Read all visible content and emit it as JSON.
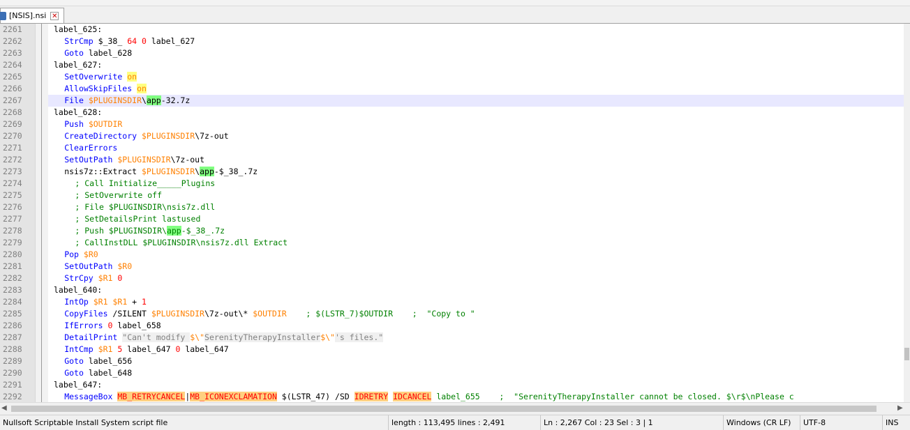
{
  "tab": {
    "label": "[NSIS].nsi",
    "close_icon": "close-icon",
    "file_icon": "save-disk-icon"
  },
  "colors": {
    "keyword": "#0000ff",
    "variable": "#ff8000",
    "number": "#ff0000",
    "comment": "#008000",
    "string": "#808080",
    "current_line": "#e8e8ff"
  },
  "editor": {
    "current_line": 2267,
    "lines": [
      {
        "num": "2261",
        "tokens": [
          {
            "t": "label_625:",
            "c": "default"
          }
        ],
        "indent": 0
      },
      {
        "num": "2262",
        "tokens": [
          {
            "t": "StrCmp",
            "c": "keyword"
          },
          {
            "t": " $_38_ ",
            "c": "default"
          },
          {
            "t": "64",
            "c": "number"
          },
          {
            "t": " ",
            "c": "default"
          },
          {
            "t": "0",
            "c": "number"
          },
          {
            "t": " label_627",
            "c": "default"
          }
        ],
        "indent": 2
      },
      {
        "num": "2263",
        "tokens": [
          {
            "t": "Goto",
            "c": "keyword"
          },
          {
            "t": " label_628",
            "c": "default"
          }
        ],
        "indent": 2
      },
      {
        "num": "2264",
        "tokens": [
          {
            "t": "label_627:",
            "c": "default"
          }
        ],
        "indent": 0
      },
      {
        "num": "2265",
        "tokens": [
          {
            "t": "SetOverwrite",
            "c": "keyword"
          },
          {
            "t": " ",
            "c": "default"
          },
          {
            "t": "on",
            "c": "variable",
            "hl": "yellow"
          }
        ],
        "indent": 2
      },
      {
        "num": "2266",
        "tokens": [
          {
            "t": "AllowSkipFiles",
            "c": "keyword"
          },
          {
            "t": " ",
            "c": "default"
          },
          {
            "t": "on",
            "c": "variable",
            "hl": "yellow"
          }
        ],
        "indent": 2
      },
      {
        "num": "2267",
        "tokens": [
          {
            "t": "File",
            "c": "keyword"
          },
          {
            "t": " ",
            "c": "default"
          },
          {
            "t": "$PLUGINSDIR",
            "c": "variable"
          },
          {
            "t": "\\",
            "c": "default"
          },
          {
            "t": "app",
            "c": "default",
            "hl": "green"
          },
          {
            "t": "-32.7z",
            "c": "default"
          }
        ],
        "indent": 2
      },
      {
        "num": "2268",
        "tokens": [
          {
            "t": "label_628:",
            "c": "default"
          }
        ],
        "indent": 0
      },
      {
        "num": "2269",
        "tokens": [
          {
            "t": "Push",
            "c": "keyword"
          },
          {
            "t": " ",
            "c": "default"
          },
          {
            "t": "$OUTDIR",
            "c": "variable"
          }
        ],
        "indent": 2
      },
      {
        "num": "2270",
        "tokens": [
          {
            "t": "CreateDirectory",
            "c": "keyword"
          },
          {
            "t": " ",
            "c": "default"
          },
          {
            "t": "$PLUGINSDIR",
            "c": "variable"
          },
          {
            "t": "\\7z-out",
            "c": "default"
          }
        ],
        "indent": 2
      },
      {
        "num": "2271",
        "tokens": [
          {
            "t": "ClearErrors",
            "c": "keyword"
          }
        ],
        "indent": 2
      },
      {
        "num": "2272",
        "tokens": [
          {
            "t": "SetOutPath",
            "c": "keyword"
          },
          {
            "t": " ",
            "c": "default"
          },
          {
            "t": "$PLUGINSDIR",
            "c": "variable"
          },
          {
            "t": "\\7z-out",
            "c": "default"
          }
        ],
        "indent": 2
      },
      {
        "num": "2273",
        "tokens": [
          {
            "t": "nsis7z::Extract",
            "c": "default"
          },
          {
            "t": " ",
            "c": "default"
          },
          {
            "t": "$PLUGINSDIR",
            "c": "variable"
          },
          {
            "t": "\\",
            "c": "default"
          },
          {
            "t": "app",
            "c": "default",
            "hl": "green"
          },
          {
            "t": "-$_38_.7z",
            "c": "default"
          }
        ],
        "indent": 2
      },
      {
        "num": "2274",
        "tokens": [
          {
            "t": "; Call Initialize_____Plugins",
            "c": "comment"
          }
        ],
        "indent": 4
      },
      {
        "num": "2275",
        "tokens": [
          {
            "t": "; SetOverwrite off",
            "c": "comment"
          }
        ],
        "indent": 4
      },
      {
        "num": "2276",
        "tokens": [
          {
            "t": "; File $PLUGINSDIR\\nsis7z.dll",
            "c": "comment"
          }
        ],
        "indent": 4
      },
      {
        "num": "2277",
        "tokens": [
          {
            "t": "; SetDetailsPrint lastused",
            "c": "comment"
          }
        ],
        "indent": 4
      },
      {
        "num": "2278",
        "tokens": [
          {
            "t": "; Push $PLUGINSDIR\\",
            "c": "comment"
          },
          {
            "t": "app",
            "c": "comment",
            "hl": "green"
          },
          {
            "t": "-$_38_.7z",
            "c": "comment"
          }
        ],
        "indent": 4
      },
      {
        "num": "2279",
        "tokens": [
          {
            "t": "; CallInstDLL $PLUGINSDIR\\nsis7z.dll Extract",
            "c": "comment"
          }
        ],
        "indent": 4
      },
      {
        "num": "2280",
        "tokens": [
          {
            "t": "Pop",
            "c": "keyword"
          },
          {
            "t": " ",
            "c": "default"
          },
          {
            "t": "$R0",
            "c": "variable"
          }
        ],
        "indent": 2
      },
      {
        "num": "2281",
        "tokens": [
          {
            "t": "SetOutPath",
            "c": "keyword"
          },
          {
            "t": " ",
            "c": "default"
          },
          {
            "t": "$R0",
            "c": "variable"
          }
        ],
        "indent": 2
      },
      {
        "num": "2282",
        "tokens": [
          {
            "t": "StrCpy",
            "c": "keyword"
          },
          {
            "t": " ",
            "c": "default"
          },
          {
            "t": "$R1",
            "c": "variable"
          },
          {
            "t": " ",
            "c": "default"
          },
          {
            "t": "0",
            "c": "number"
          }
        ],
        "indent": 2
      },
      {
        "num": "2283",
        "tokens": [
          {
            "t": "label_640:",
            "c": "default"
          }
        ],
        "indent": 0
      },
      {
        "num": "2284",
        "tokens": [
          {
            "t": "IntOp",
            "c": "keyword"
          },
          {
            "t": " ",
            "c": "default"
          },
          {
            "t": "$R1",
            "c": "variable"
          },
          {
            "t": " ",
            "c": "default"
          },
          {
            "t": "$R1",
            "c": "variable"
          },
          {
            "t": " + ",
            "c": "default"
          },
          {
            "t": "1",
            "c": "number"
          }
        ],
        "indent": 2
      },
      {
        "num": "2285",
        "tokens": [
          {
            "t": "CopyFiles",
            "c": "keyword"
          },
          {
            "t": " /SILENT ",
            "c": "default"
          },
          {
            "t": "$PLUGINSDIR",
            "c": "variable"
          },
          {
            "t": "\\7z-out\\* ",
            "c": "default"
          },
          {
            "t": "$OUTDIR",
            "c": "variable"
          },
          {
            "t": "    ; $(LSTR_7)$OUTDIR    ;  \"Copy to \"",
            "c": "comment"
          }
        ],
        "indent": 2
      },
      {
        "num": "2286",
        "tokens": [
          {
            "t": "IfErrors",
            "c": "keyword"
          },
          {
            "t": " ",
            "c": "default"
          },
          {
            "t": "0",
            "c": "number"
          },
          {
            "t": " label_658",
            "c": "default"
          }
        ],
        "indent": 2
      },
      {
        "num": "2287",
        "tokens": [
          {
            "t": "DetailPrint",
            "c": "keyword"
          },
          {
            "t": " ",
            "c": "default"
          },
          {
            "t": "\"Can't modify ",
            "c": "string"
          },
          {
            "t": "$\\\"",
            "c": "variable"
          },
          {
            "t": "SerenityTherapyInstaller",
            "c": "string"
          },
          {
            "t": "$\\\"",
            "c": "variable"
          },
          {
            "t": "'s files.\"",
            "c": "string"
          }
        ],
        "indent": 2
      },
      {
        "num": "2288",
        "tokens": [
          {
            "t": "IntCmp",
            "c": "keyword"
          },
          {
            "t": " ",
            "c": "default"
          },
          {
            "t": "$R1",
            "c": "variable"
          },
          {
            "t": " ",
            "c": "default"
          },
          {
            "t": "5",
            "c": "number"
          },
          {
            "t": " label_647 ",
            "c": "default"
          },
          {
            "t": "0",
            "c": "number"
          },
          {
            "t": " label_647",
            "c": "default"
          }
        ],
        "indent": 2
      },
      {
        "num": "2289",
        "tokens": [
          {
            "t": "Goto",
            "c": "keyword"
          },
          {
            "t": " label_656",
            "c": "default"
          }
        ],
        "indent": 2
      },
      {
        "num": "2290",
        "tokens": [
          {
            "t": "Goto",
            "c": "keyword"
          },
          {
            "t": " label_648",
            "c": "default"
          }
        ],
        "indent": 2
      },
      {
        "num": "2291",
        "tokens": [
          {
            "t": "label_647:",
            "c": "default"
          }
        ],
        "indent": 0
      },
      {
        "num": "2292",
        "tokens": [
          {
            "t": "MessageBox",
            "c": "keyword"
          },
          {
            "t": " ",
            "c": "default"
          },
          {
            "t": "MB_RETRYCANCEL",
            "c": "number",
            "hl": "orange"
          },
          {
            "t": "|",
            "c": "default"
          },
          {
            "t": "MB_ICONEXCLAMATION",
            "c": "number",
            "hl": "orange"
          },
          {
            "t": " $(LSTR_47) /SD ",
            "c": "default"
          },
          {
            "t": "IDRETRY",
            "c": "number",
            "hl": "orange"
          },
          {
            "t": " ",
            "c": "default"
          },
          {
            "t": "IDCANCEL",
            "c": "number",
            "hl": "orange"
          },
          {
            "t": " label_655    ;  \"SerenityTherapyInstaller cannot be closed. $\\r$\\nPlease c",
            "c": "comment"
          }
        ],
        "indent": 2
      }
    ]
  },
  "status": {
    "file_type": "Nullsoft Scriptable Install System script file",
    "length_lines": "length : 113,495    lines : 2,491",
    "position": "Ln : 2,267    Col : 23    Sel : 3 | 1",
    "eol": "Windows (CR LF)",
    "encoding": "UTF-8",
    "mode": "INS"
  }
}
